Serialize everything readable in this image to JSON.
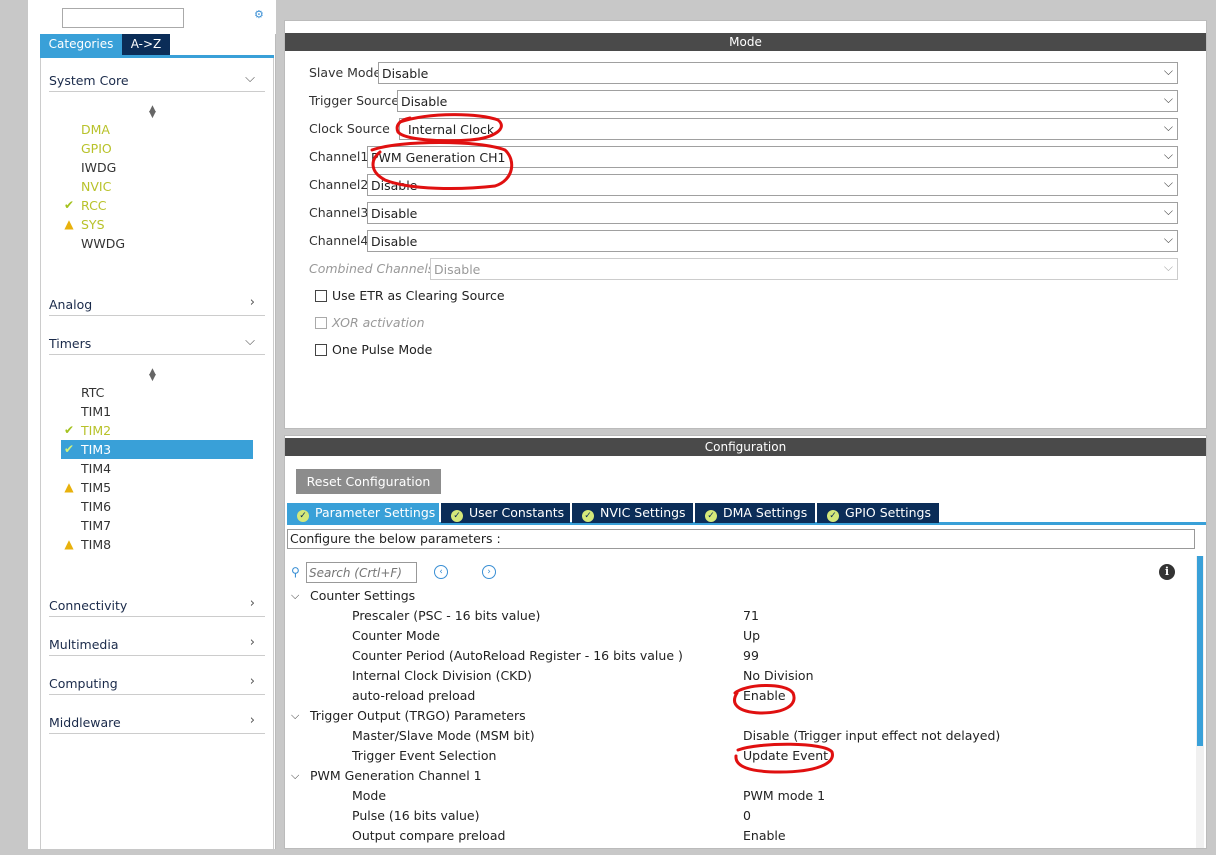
{
  "sidebar": {
    "tabs": [
      "Categories",
      "A->Z"
    ],
    "sections": {
      "system_core": {
        "label": "System Core",
        "items": [
          {
            "label": "DMA",
            "status": "none",
            "color": "yellow"
          },
          {
            "label": "GPIO",
            "status": "none",
            "color": "yellow"
          },
          {
            "label": "IWDG",
            "status": "none",
            "color": "plain"
          },
          {
            "label": "NVIC",
            "status": "none",
            "color": "yellow"
          },
          {
            "label": "RCC",
            "status": "ok",
            "color": "yellow"
          },
          {
            "label": "SYS",
            "status": "warn",
            "color": "yellow"
          },
          {
            "label": "WWDG",
            "status": "none",
            "color": "plain"
          }
        ]
      },
      "analog": {
        "label": "Analog"
      },
      "timers": {
        "label": "Timers",
        "items": [
          {
            "label": "RTC",
            "status": "none",
            "color": "plain"
          },
          {
            "label": "TIM1",
            "status": "none",
            "color": "plain"
          },
          {
            "label": "TIM2",
            "status": "ok",
            "color": "yellow"
          },
          {
            "label": "TIM3",
            "status": "ok",
            "color": "selected"
          },
          {
            "label": "TIM4",
            "status": "none",
            "color": "plain"
          },
          {
            "label": "TIM5",
            "status": "warn",
            "color": "plain"
          },
          {
            "label": "TIM6",
            "status": "none",
            "color": "plain"
          },
          {
            "label": "TIM7",
            "status": "none",
            "color": "plain"
          },
          {
            "label": "TIM8",
            "status": "warn",
            "color": "plain"
          }
        ]
      },
      "connectivity": {
        "label": "Connectivity"
      },
      "multimedia": {
        "label": "Multimedia"
      },
      "computing": {
        "label": "Computing"
      },
      "middleware": {
        "label": "Middleware"
      }
    }
  },
  "mode": {
    "header": "Mode",
    "fields": [
      {
        "label": "Slave Mode",
        "value": "Disable",
        "disabled": false
      },
      {
        "label": "Trigger Source",
        "value": "Disable",
        "disabled": false
      },
      {
        "label": "Clock Source",
        "value": "Internal Clock",
        "disabled": false
      },
      {
        "label": "Channel1",
        "value": "PWM Generation CH1",
        "disabled": false
      },
      {
        "label": "Channel2",
        "value": "Disable",
        "disabled": false
      },
      {
        "label": "Channel3",
        "value": "Disable",
        "disabled": false
      },
      {
        "label": "Channel4",
        "value": "Disable",
        "disabled": false
      },
      {
        "label": "Combined Channels",
        "value": "Disable",
        "disabled": true
      }
    ],
    "checkboxes": [
      {
        "label": "Use ETR as Clearing Source",
        "disabled": false
      },
      {
        "label": "XOR activation",
        "disabled": true
      },
      {
        "label": "One Pulse Mode",
        "disabled": false
      }
    ]
  },
  "configuration": {
    "header": "Configuration",
    "reset_label": "Reset Configuration",
    "tabs": [
      "Parameter Settings",
      "User Constants",
      "NVIC Settings",
      "DMA Settings",
      "GPIO Settings"
    ],
    "hint": "Configure the below parameters :",
    "search_placeholder": "Search (Crtl+F)",
    "groups": [
      {
        "label": "Counter Settings",
        "params": [
          {
            "name": "Prescaler (PSC - 16 bits value)",
            "value": "71"
          },
          {
            "name": "Counter Mode",
            "value": "Up"
          },
          {
            "name": "Counter Period (AutoReload Register - 16 bits value )",
            "value": "99"
          },
          {
            "name": "Internal Clock Division (CKD)",
            "value": "No Division"
          },
          {
            "name": "auto-reload preload",
            "value": "Enable"
          }
        ]
      },
      {
        "label": "Trigger Output (TRGO) Parameters",
        "params": [
          {
            "name": "Master/Slave Mode (MSM bit)",
            "value": "Disable (Trigger input effect not delayed)"
          },
          {
            "name": "Trigger Event Selection",
            "value": "Update Event"
          }
        ]
      },
      {
        "label": "PWM Generation Channel 1",
        "params": [
          {
            "name": "Mode",
            "value": "PWM mode 1"
          },
          {
            "name": "Pulse (16 bits value)",
            "value": "0"
          },
          {
            "name": "Output compare preload",
            "value": "Enable"
          }
        ]
      }
    ]
  },
  "colors": {
    "accent": "#39a0d8",
    "dark_tab": "#0b2d58",
    "annotation": "#e01010"
  }
}
